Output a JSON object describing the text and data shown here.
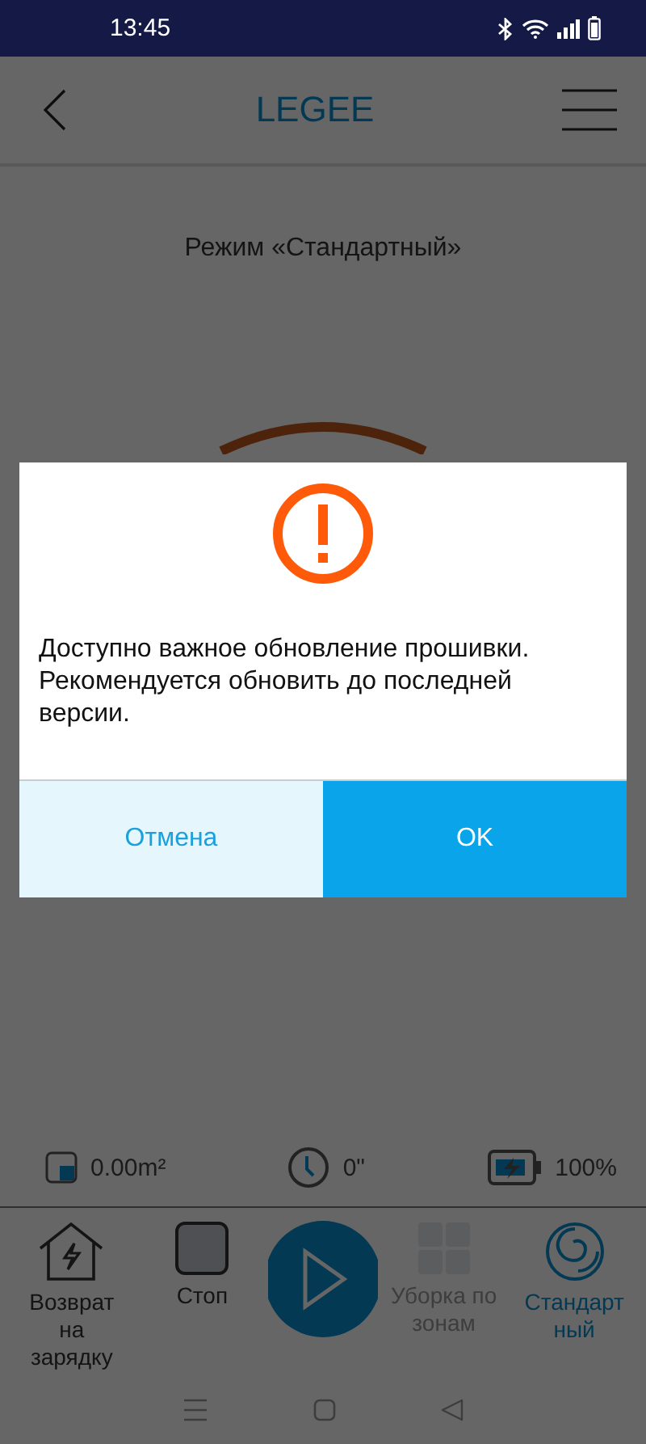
{
  "status_bar": {
    "time": "13:45"
  },
  "header": {
    "title": "LEGEE"
  },
  "mode": {
    "label": "Режим «Стандартный»"
  },
  "stats": [
    {
      "kind": "area",
      "value": "0.00m²"
    },
    {
      "kind": "time",
      "value": "0\""
    },
    {
      "kind": "battery",
      "value": "100%"
    }
  ],
  "nav": [
    {
      "kind": "home",
      "label": "Возврат на зарядку",
      "selected": false,
      "disabled": false
    },
    {
      "kind": "stop",
      "label": "Стоп",
      "selected": false,
      "disabled": false
    },
    {
      "kind": "play",
      "selected": false,
      "disabled": false
    },
    {
      "kind": "zones",
      "label": "Уборка по зонам",
      "selected": false,
      "disabled": true
    },
    {
      "kind": "standard",
      "label": "Стандартный",
      "selected": true,
      "disabled": false
    }
  ],
  "dialog": {
    "message": "Доступно важное обновление прошивки. Рекомендуется обновить до последней версии.",
    "buttons": [
      {
        "kind": "cancel",
        "label": "Отмена"
      },
      {
        "kind": "ok",
        "label": "OK"
      }
    ]
  }
}
